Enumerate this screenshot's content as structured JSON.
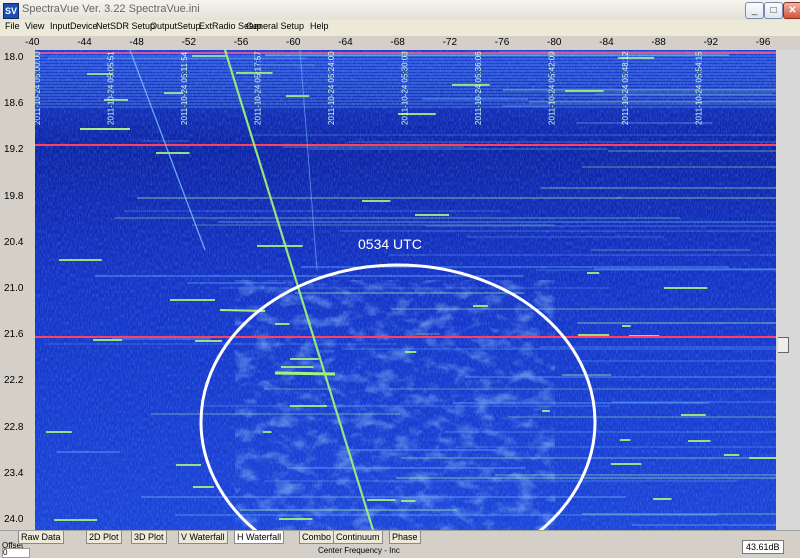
{
  "window": {
    "title": "SpectraVue Ver. 3.22  SpectraVue.ini",
    "app_icon": "SV"
  },
  "window_controls": {
    "minimize": "_",
    "maximize": "□",
    "close": "✕"
  },
  "menu": [
    "File",
    "View",
    "InputDevice",
    "NetSDR Setup",
    "OutputSetup",
    "ExtRadio Setup",
    "General Setup",
    "Help"
  ],
  "x_ticks": [
    "-40",
    "-44",
    "-48",
    "-52",
    "-56",
    "-60",
    "-64",
    "-68",
    "-72",
    "-76",
    "-80",
    "-84",
    "-88",
    "-92",
    "-96"
  ],
  "y_ticks": [
    "18.0",
    "18.6",
    "19.2",
    "19.8",
    "20.4",
    "21.0",
    "21.6",
    "22.2",
    "22.8",
    "23.4",
    "24.0"
  ],
  "annotation": {
    "label": "0534 UTC"
  },
  "timestamps": [
    "2011-10-24 05:00:00",
    "2011-10-24 05:05:51",
    "2011-10-24 05:11:54",
    "2011-10-24 05:17:57",
    "2011-10-24 05:24:00",
    "2011-10-24 05:30:03",
    "2011-10-24 05:36:06",
    "2011-10-24 05:42:09",
    "2011-10-24 05:48:12",
    "2011-10-24 05:54:15"
  ],
  "tabs": [
    "Raw Data",
    "2D Plot",
    "3D Plot",
    "V Waterfall",
    "H Waterfall",
    "Combo",
    "Continuum",
    "Phase"
  ],
  "active_tab": "H Waterfall",
  "status": {
    "offset_label": "Offset",
    "offset_value": "0",
    "center_freq_label": "Center Frequency - Inc",
    "db": "43.61dB"
  },
  "colors": {
    "background": "#1436c8",
    "deep": "#0a1c9a",
    "signal": "#9ce87a",
    "marker_line": "#ff4060",
    "annotation": "#ffffff"
  }
}
